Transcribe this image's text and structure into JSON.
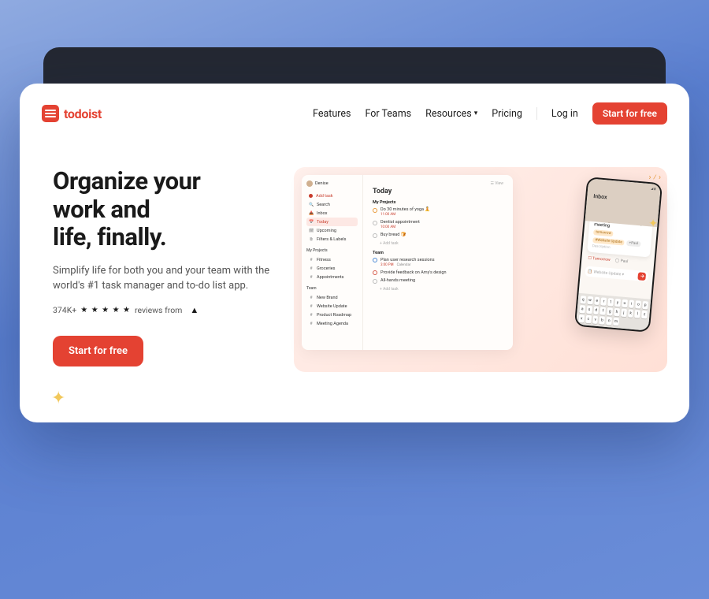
{
  "brand": {
    "name": "todoist"
  },
  "nav": {
    "features": "Features",
    "for_teams": "For Teams",
    "resources": "Resources",
    "pricing": "Pricing",
    "login": "Log in",
    "cta": "Start for free"
  },
  "hero": {
    "headline_l1": "Organize your",
    "headline_l2": "work and",
    "headline_l3": "life, finally.",
    "sub": "Simplify life for both you and your team with the world's #1 task manager and to-do list app.",
    "reviews_count": "374K+",
    "reviews_tail": "reviews from",
    "cta": "Start for free"
  },
  "mock": {
    "user": "Denise",
    "view_label": "View",
    "side_add": "Add task",
    "side_items": [
      "Search",
      "Inbox",
      "Today",
      "Upcoming",
      "Filters & Labels"
    ],
    "side_active_index": 2,
    "projects_label": "My Projects",
    "projects": [
      "Fitness",
      "Groceries",
      "Appointments"
    ],
    "team_label": "Team",
    "team": [
      "New Brand",
      "Website Update",
      "Product Roadmap",
      "Meeting Agenda"
    ],
    "main_title": "Today",
    "section_my": "My Projects",
    "section_team": "Team",
    "tasks_my": [
      {
        "title": "Do 30 minutes of yoga 🧘",
        "meta": "11:00 AM",
        "meta2": "",
        "color": "orange"
      },
      {
        "title": "Dentist appointment",
        "meta": "10:00 AM",
        "meta2": "",
        "color": ""
      },
      {
        "title": "Buy bread 🍞",
        "meta": "",
        "meta2": "",
        "color": ""
      }
    ],
    "tasks_team": [
      {
        "title": "Plan user research sessions",
        "meta": "3:00 PM",
        "meta2": "Calendar",
        "color": "blue"
      },
      {
        "title": "Provide feedback on Amy's design",
        "meta": "",
        "meta2": "",
        "color": "red"
      },
      {
        "title": "All-hands meeting",
        "meta": "",
        "meta2": "",
        "color": ""
      }
    ],
    "add_task_row": "Add task"
  },
  "phone": {
    "inbox": "Inbox",
    "card_title": "Write agenda for Monday's meeting",
    "chip_tomorrow": "tomorrow",
    "chip_project": "#Website Update",
    "chip_person": "+Paul",
    "desc": "Description",
    "row_tomorrow": "Tomorrow",
    "row_paul": "Paul",
    "input": "Website Update",
    "keys_r1": [
      "q",
      "w",
      "e",
      "r",
      "t",
      "y",
      "u",
      "i",
      "o",
      "p"
    ],
    "keys_r2": [
      "a",
      "s",
      "d",
      "f",
      "g",
      "h",
      "j",
      "k",
      "l"
    ],
    "keys_r3": [
      "z",
      "x",
      "c",
      "v",
      "b",
      "n",
      "m"
    ]
  }
}
